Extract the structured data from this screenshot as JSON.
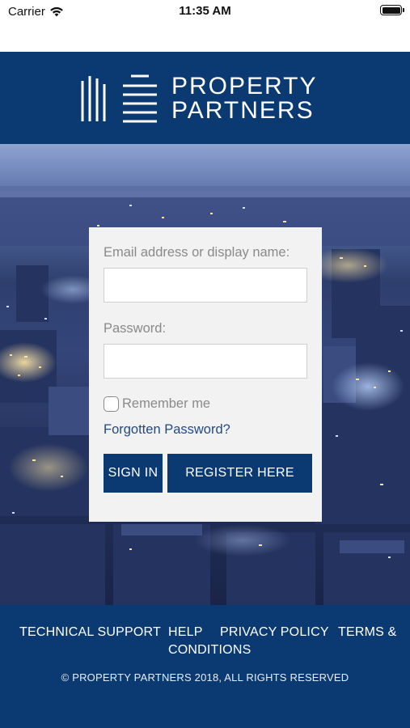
{
  "status_bar": {
    "carrier": "Carrier",
    "time": "11:35 AM"
  },
  "header": {
    "logo_line1": "PROPERTY",
    "logo_line2": "PARTNERS"
  },
  "login": {
    "email_label": "Email address or display name:",
    "email_value": "",
    "password_label": "Password:",
    "password_value": "",
    "remember_label": "Remember me",
    "remember_checked": false,
    "forgot_link": "Forgotten Password?",
    "signin_label": "SIGN IN",
    "register_label": "REGISTER HERE"
  },
  "footer": {
    "links": [
      "TECHNICAL SUPPORT",
      "HELP",
      "PRIVACY POLICY",
      "TERMS &",
      "CONDITIONS"
    ],
    "copyright": "© PROPERTY PARTNERS 2018, ALL RIGHTS RESERVED"
  },
  "colors": {
    "brand_navy": "#0b3a72",
    "card_bg": "#f2f2f2",
    "link_blue": "#1f4a86"
  }
}
